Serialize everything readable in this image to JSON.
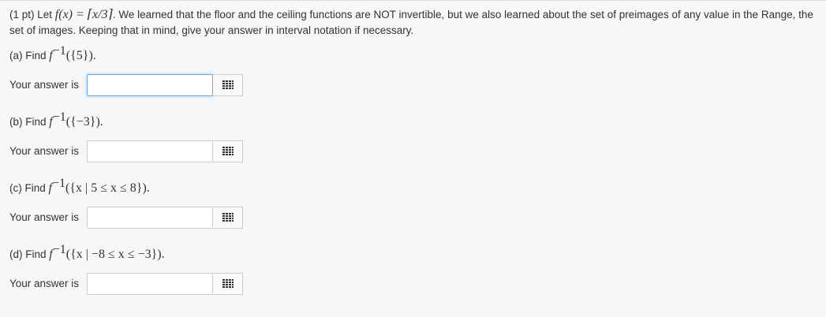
{
  "problem": {
    "points_label": "(1 pt) Let",
    "function_def": "f(x) = ⌈x/3⌉",
    "intro_text": ". We learned that the floor and the ceiling functions are NOT invertible, but we also learned about the set of preimages of any value in the Range, the set of images. Keeping that in mind, give your answer in interval notation if necessary."
  },
  "parts": [
    {
      "label": "(a) Find",
      "set_expr": "({5}).",
      "answer_label": "Your answer is",
      "value": ""
    },
    {
      "label": "(b) Find",
      "set_expr": "({−3}).",
      "answer_label": "Your answer is",
      "value": ""
    },
    {
      "label": "(c) Find",
      "set_expr": "({x | 5 ≤ x ≤ 8}).",
      "answer_label": "Your answer is",
      "value": ""
    },
    {
      "label": "(d) Find",
      "set_expr": "({x | −8 ≤ x ≤ −3}).",
      "answer_label": "Your answer is",
      "value": ""
    }
  ],
  "inverse_symbol": {
    "base": "f",
    "exponent": "−1"
  },
  "icons": {
    "palette": "equation-palette-grid-icon"
  },
  "colors": {
    "focus_border": "#66afe9",
    "page_bg": "#f7f7f7",
    "text": "#333333"
  }
}
